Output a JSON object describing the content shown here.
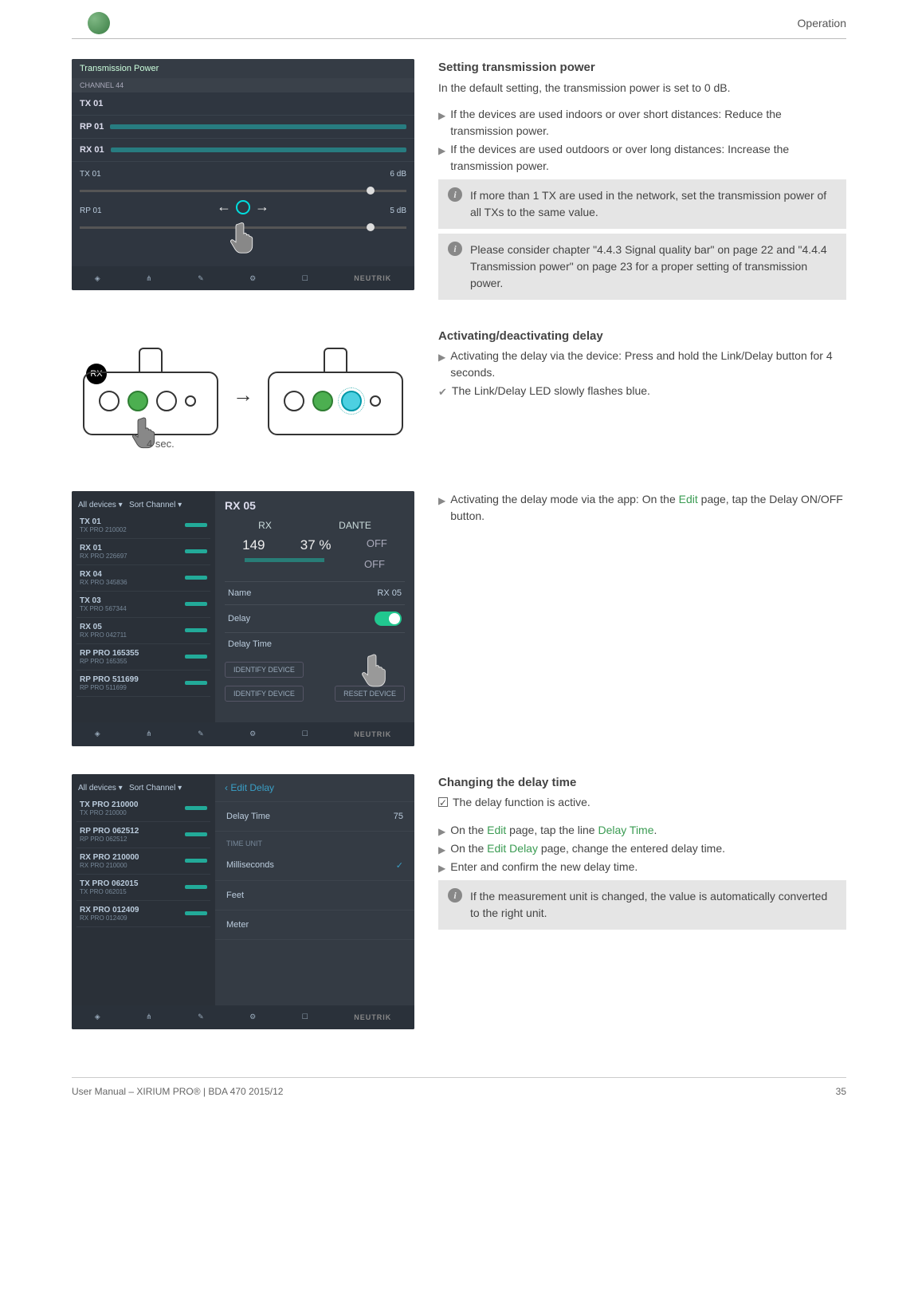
{
  "header": {
    "title": "Operation"
  },
  "section1": {
    "title": "Setting transmission power",
    "para": "In the default setting, the transmission power is set to 0 dB.",
    "action1": "If the devices are used indoors or over short distances: Reduce the transmission power.",
    "action2": "If the devices are used outdoors or over long distances: Increase the transmission power.",
    "info1": "If more than 1 TX are used in the network, set the transmission power of all TXs to the same value.",
    "info2": "Please consider chapter \"4.4.3 Signal quality bar\" on page 22 and \"4.4.4 Transmission power\" on page 23 for a proper setting of transmission power."
  },
  "screenshot1": {
    "header": "Transmission Power",
    "ch_header": "CHANNEL 44",
    "tx": "TX 01",
    "rp": "RP 01",
    "rx": "RX 01",
    "tx_val": "6 dB",
    "rp_val": "5 dB",
    "brand": "NEUTRIK"
  },
  "section2": {
    "title": "Activating/deactivating delay",
    "action1": "Activating the delay via the device: Press and hold the Link/Delay button for 4 seconds.",
    "result1": "The Link/Delay LED slowly flashes blue."
  },
  "diagram": {
    "rx_badge": "RX",
    "time_label": "4 sec."
  },
  "section3": {
    "action1_pre": "Activating the delay mode via the app: On the ",
    "action1_link": "Edit",
    "action1_post": " page, tap the Delay ON/OFF button."
  },
  "screenshot2": {
    "dropdown": "All devices",
    "sort": "Sort Channel",
    "panel_title": "RX 05",
    "rx_label": "RX",
    "dante_label": "DANTE",
    "val1": "149",
    "val2": "37 %",
    "off": "OFF",
    "name_label": "Name",
    "name_val": "RX 05",
    "delay_label": "Delay",
    "delay_time_label": "Delay Time",
    "identify": "IDENTIFY DEVICE",
    "reset": "RESET DEVICE",
    "brand": "NEUTRIK",
    "list": [
      {
        "name": "TX 01",
        "sub": "TX PRO 210002"
      },
      {
        "name": "RX 01",
        "sub": "RX PRO 226697"
      },
      {
        "name": "RX 04",
        "sub": "RX PRO 345836"
      },
      {
        "name": "TX 03",
        "sub": "TX PRO 567344"
      },
      {
        "name": "RX 05",
        "sub": "RX PRO 042711"
      },
      {
        "name": "RP PRO 165355",
        "sub": "RP PRO 165355"
      },
      {
        "name": "RP PRO 511699",
        "sub": "RP PRO 511699"
      }
    ]
  },
  "section4": {
    "title": "Changing the delay time",
    "precond": "The delay function is active.",
    "action1_pre": "On the ",
    "action1_link": "Edit",
    "action1_mid": " page, tap the line ",
    "action1_link2": "Delay Time",
    "action1_post": ".",
    "action2_pre": "On the ",
    "action2_link": "Edit Delay",
    "action2_post": " page, change the entered delay time.",
    "action3": "Enter and confirm the new delay time.",
    "info1": "If the measurement unit is changed, the value is automatically converted to the right unit."
  },
  "screenshot3": {
    "dropdown": "All devices",
    "sort": "Sort Channel",
    "crumb": "Edit Delay",
    "delay_time_label": "Delay Time",
    "delay_time_val": "75",
    "unit_header": "TIME UNIT",
    "ms": "Milliseconds",
    "feet": "Feet",
    "meter": "Meter",
    "brand": "NEUTRIK",
    "list": [
      {
        "name": "TX PRO 210000",
        "sub": "TX PRO 210000"
      },
      {
        "name": "RP PRO 062512",
        "sub": "RP PRO 062512"
      },
      {
        "name": "RX PRO 210000",
        "sub": "RX PRO 210000"
      },
      {
        "name": "TX PRO 062015",
        "sub": "TX PRO 062015"
      },
      {
        "name": "RX PRO 012409",
        "sub": "RX PRO 012409"
      }
    ]
  },
  "footer": {
    "left": "User Manual – XIRIUM PRO® | BDA 470 2015/12",
    "page": "35"
  }
}
